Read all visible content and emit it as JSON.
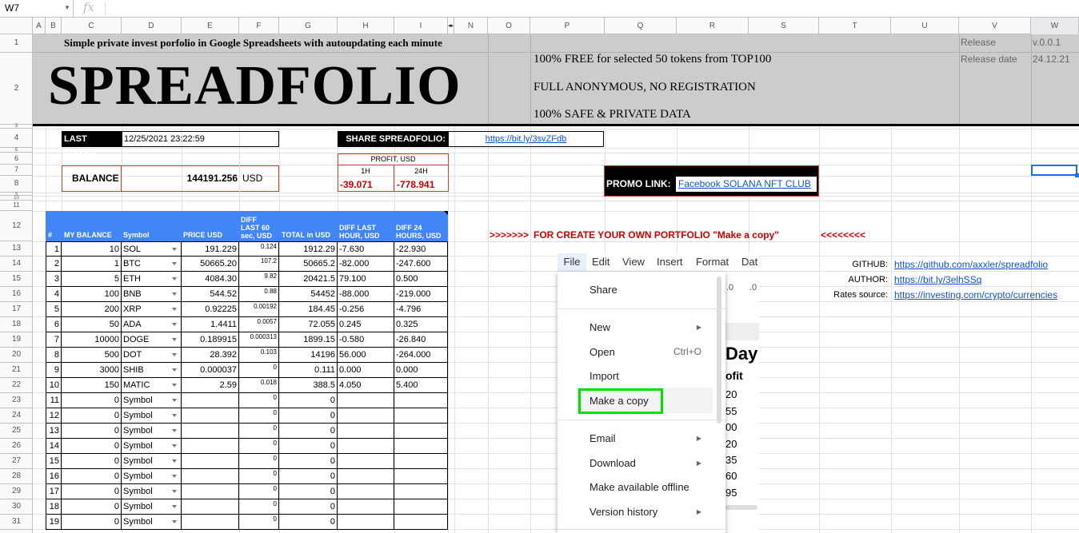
{
  "formula_bar": {
    "cell_ref": "W7",
    "fx": "fx"
  },
  "columns": [
    "A",
    "B",
    "C",
    "D",
    "E",
    "F",
    "G",
    "H",
    "I",
    "N",
    "O",
    "P",
    "Q",
    "R",
    "S",
    "T",
    "U",
    "V",
    "W"
  ],
  "rows": [
    "1",
    "2",
    "3",
    "4",
    "5",
    "6",
    "7",
    "8",
    "9",
    "10",
    "11",
    "12",
    "13",
    "14",
    "15",
    "16",
    "17",
    "18",
    "19",
    "20",
    "21",
    "22",
    "23",
    "24",
    "25",
    "26",
    "27",
    "28",
    "29",
    "30",
    "31"
  ],
  "header": {
    "subtitle": "Simple private invest porfolio in Google Spreadsheets with autoupdating each minute",
    "title": "SPREADFOLIO",
    "features": [
      "100% FREE for selected 50 tokens from TOP100",
      "FULL ANONYMOUS, NO REGISTRATION",
      "100% SAFE & PRIVATE DATA"
    ],
    "release_label": "Release",
    "release_value": "v.0.0.1",
    "release_date_label": "Release date",
    "release_date_value": "24.12.21"
  },
  "last_update": {
    "label": "LAST UPDATE",
    "value": "12/25/2021 23:22:59"
  },
  "share": {
    "label": "SHARE SPREADFOLIO:",
    "link": "https://bit.ly/3svZFdb"
  },
  "balance": {
    "label": "BALANCE",
    "value": "144191.256",
    "currency": "USD"
  },
  "profit": {
    "label": "PROFIT, USD",
    "h1_label": "1H",
    "h24_label": "24H",
    "h1_value": "-39.071",
    "h24_value": "-778.941"
  },
  "promo": {
    "label": "PROMO LINK:",
    "link": "Facebook SOLANA NFT CLUB"
  },
  "cta": {
    "left": ">>>>>>>",
    "text": "FOR CREATE YOUR OWN PORTFOLIO \"Make a copy\"",
    "right": "<<<<<<<<"
  },
  "info": [
    {
      "label": "GITHUB:",
      "link": "https://github.com/axxler/spreadfolio"
    },
    {
      "label": "AUTHOR:",
      "link": "https://bit.ly/3elhSSq"
    },
    {
      "label": "Rates source:",
      "link": "https://investing.com/crypto/currencies"
    }
  ],
  "table": {
    "headers": [
      "#",
      "MY BALANCE",
      "Symbol",
      "PRICE USD",
      "DIFF LAST 60 sec, USD",
      "TOTAL in USD",
      "DIFF LAST HOUR, USD",
      "DIFF 24 HOURS, USD"
    ],
    "header_lines": {
      "diff60": [
        "DIFF",
        "LAST 60",
        "sec, USD"
      ],
      "diffh": [
        "DIFF LAST",
        "HOUR, USD"
      ],
      "diff24": [
        "DIFF 24",
        "HOURS, USD"
      ]
    },
    "rows": [
      [
        "1",
        "10",
        "SOL",
        "191.229",
        "0.124",
        "1912.29",
        "-7.630",
        "-22.930"
      ],
      [
        "2",
        "1",
        "BTC",
        "50665.20",
        "107.2",
        "50665.2",
        "-82.000",
        "-247.600"
      ],
      [
        "3",
        "5",
        "ETH",
        "4084.30",
        "9.82",
        "20421.5",
        "79.100",
        "0.500"
      ],
      [
        "4",
        "100",
        "BNB",
        "544.52",
        "0.88",
        "54452",
        "-88.000",
        "-219.000"
      ],
      [
        "5",
        "200",
        "XRP",
        "0.92225",
        "0.00192",
        "184.45",
        "-0.256",
        "-4.796"
      ],
      [
        "6",
        "50",
        "ADA",
        "1.4411",
        "0.0057",
        "72.055",
        "0.245",
        "0.325"
      ],
      [
        "7",
        "10000",
        "DOGE",
        "0.189915",
        "0.000313",
        "1899.15",
        "-0.580",
        "-26.840"
      ],
      [
        "8",
        "500",
        "DOT",
        "28.392",
        "0.103",
        "14196",
        "56.000",
        "-264.000"
      ],
      [
        "9",
        "3000",
        "SHIB",
        "0.000037",
        "0",
        "0.111",
        "0.000",
        "0.000"
      ],
      [
        "10",
        "150",
        "MATIC",
        "2.59",
        "0.018",
        "388.5",
        "4.050",
        "5.400"
      ],
      [
        "11",
        "0",
        "Symbol",
        "",
        "0",
        "0",
        "",
        ""
      ],
      [
        "12",
        "0",
        "Symbol",
        "",
        "0",
        "0",
        "",
        ""
      ],
      [
        "13",
        "0",
        "Symbol",
        "",
        "0",
        "0",
        "",
        ""
      ],
      [
        "14",
        "0",
        "Symbol",
        "",
        "0",
        "0",
        "",
        ""
      ],
      [
        "15",
        "0",
        "Symbol",
        "",
        "0",
        "0",
        "",
        ""
      ],
      [
        "16",
        "0",
        "Symbol",
        "",
        "0",
        "0",
        "",
        ""
      ],
      [
        "17",
        "0",
        "Symbol",
        "",
        "0",
        "0",
        "",
        ""
      ],
      [
        "18",
        "0",
        "Symbol",
        "",
        "0",
        "0",
        "",
        ""
      ],
      [
        "19",
        "0",
        "Symbol",
        "",
        "0",
        "0",
        "",
        ""
      ]
    ]
  },
  "menubar": [
    "File",
    "Edit",
    "View",
    "Insert",
    "Format",
    "Dat"
  ],
  "file_menu": {
    "items": [
      {
        "label": "Share",
        "submenu": false,
        "shortcut": ""
      },
      {
        "label": "New",
        "submenu": true,
        "shortcut": ""
      },
      {
        "label": "Open",
        "submenu": false,
        "shortcut": "Ctrl+O"
      },
      {
        "label": "Import",
        "submenu": false,
        "shortcut": ""
      },
      {
        "label": "Make a copy",
        "submenu": false,
        "shortcut": ""
      },
      {
        "label": "Email",
        "submenu": true,
        "shortcut": ""
      },
      {
        "label": "Download",
        "submenu": true,
        "shortcut": ""
      },
      {
        "label": "Make available offline",
        "submenu": false,
        "shortcut": ""
      },
      {
        "label": "Version history",
        "submenu": true,
        "shortcut": ""
      }
    ],
    "highlight_color": "#00e000"
  },
  "behind_menu": {
    "toolbar": [
      ".0",
      ".0"
    ],
    "heading": "Day",
    "subheading": "ofit",
    "values": [
      "20",
      "55",
      "00",
      "20",
      "35",
      "60",
      "95"
    ]
  },
  "colors": {
    "header_gray": "#cccccc",
    "table_blue": "#4285f4",
    "red": "#cc0000",
    "link": "#1155cc"
  }
}
